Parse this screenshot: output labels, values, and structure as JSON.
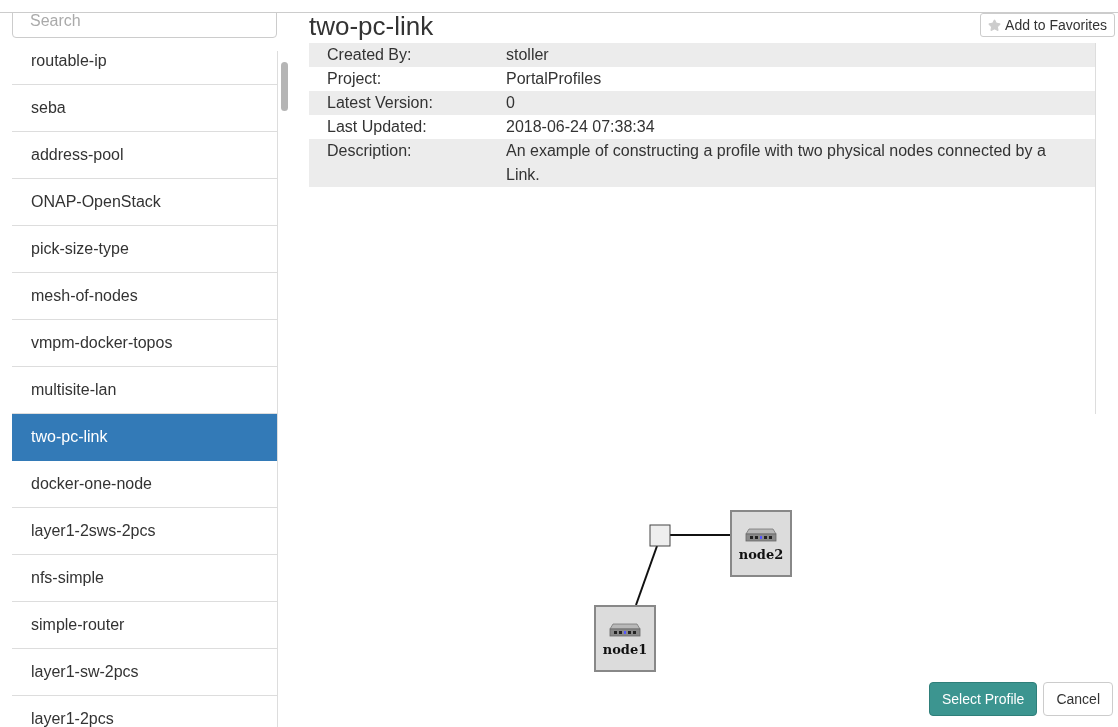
{
  "search": {
    "placeholder": "Search"
  },
  "profiles": [
    {
      "name": "routable-ip",
      "selected": false
    },
    {
      "name": "seba",
      "selected": false
    },
    {
      "name": "address-pool",
      "selected": false
    },
    {
      "name": "ONAP-OpenStack",
      "selected": false
    },
    {
      "name": "pick-size-type",
      "selected": false
    },
    {
      "name": "mesh-of-nodes",
      "selected": false
    },
    {
      "name": "vmpm-docker-topos",
      "selected": false
    },
    {
      "name": "multisite-lan",
      "selected": false
    },
    {
      "name": "two-pc-link",
      "selected": true
    },
    {
      "name": "docker-one-node",
      "selected": false
    },
    {
      "name": "layer1-2sws-2pcs",
      "selected": false
    },
    {
      "name": "nfs-simple",
      "selected": false
    },
    {
      "name": "simple-router",
      "selected": false
    },
    {
      "name": "layer1-sw-2pcs",
      "selected": false
    },
    {
      "name": "layer1-2pcs",
      "selected": false
    }
  ],
  "profile": {
    "title": "two-pc-link",
    "favorite_button": "Add to Favorites",
    "details": [
      {
        "label": "Created By:",
        "value": "stoller"
      },
      {
        "label": "Project:",
        "value": "PortalProfiles"
      },
      {
        "label": "Latest Version:",
        "value": "0"
      },
      {
        "label": "Last Updated:",
        "value": "2018-06-24 07:38:34"
      },
      {
        "label": "Description:",
        "value": "An example of constructing a profile with two physical nodes connected by a Link."
      }
    ]
  },
  "topology": {
    "nodes": [
      {
        "label": "node1"
      },
      {
        "label": "node2"
      }
    ]
  },
  "buttons": [
    {
      "label": "Select Profile",
      "kind": "primary"
    },
    {
      "label": "Cancel",
      "kind": "default"
    }
  ]
}
